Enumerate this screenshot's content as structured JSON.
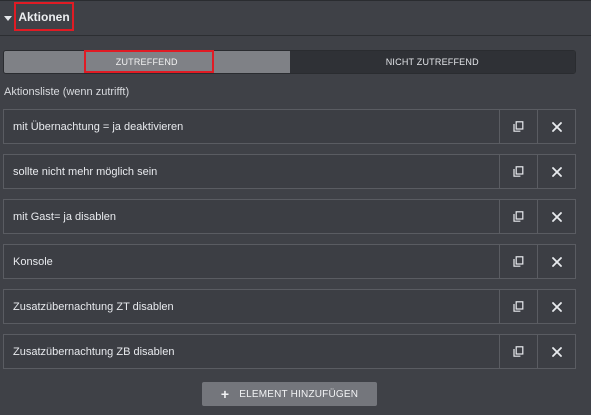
{
  "section": {
    "title": "Aktionen"
  },
  "tabs": [
    {
      "label": "ZUTREFFEND",
      "active": true
    },
    {
      "label": "NICHT ZUTREFFEND",
      "active": false
    }
  ],
  "list": {
    "label": "Aktionsliste (wenn zutrifft)",
    "items": [
      {
        "text": "mit Übernachtung = ja deaktivieren"
      },
      {
        "text": "sollte nicht mehr möglich sein"
      },
      {
        "text": "mit Gast= ja disablen"
      },
      {
        "text": "Konsole"
      },
      {
        "text": "Zusatzübernachtung ZT disablen"
      },
      {
        "text": "Zusatzübernachtung ZB disablen"
      }
    ]
  },
  "add_button": {
    "icon": "plus-icon",
    "label": "ELEMENT HINZUFÜGEN"
  },
  "colors": {
    "highlight": "#e01b24",
    "active_tab": "#7f8186",
    "background": "#3f4147"
  }
}
